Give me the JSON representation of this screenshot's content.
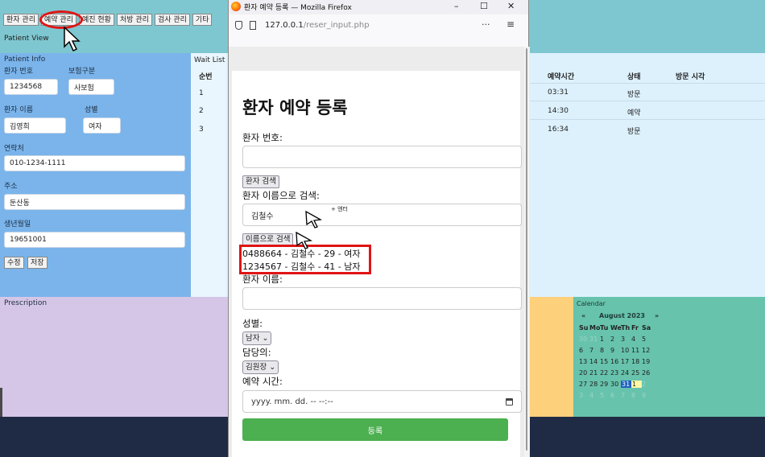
{
  "bg_app": {
    "menu": [
      "환자 관리",
      "예약 관리",
      "예진 현황",
      "처방 관리",
      "검사 관리",
      "기타"
    ],
    "patient_view": "Patient View",
    "patient_info": {
      "title": "Patient Info",
      "patient_no_label": "환자 번호",
      "insurance_label": "보험구분",
      "patient_no": "1234568",
      "insurance": "사보험",
      "name_label": "환자 이름",
      "gender_label": "성별",
      "name": "김영희",
      "gender": "여자",
      "contact_label": "연락처",
      "contact": "010-1234-1111",
      "address_label": "주소",
      "address": "둔산동",
      "birth_label": "생년월일",
      "birth": "19651001",
      "edit_btn": "수정",
      "save_btn": "저장"
    },
    "wait_list": {
      "title": "Wait List",
      "col_no": "순번",
      "col_time": "예약시간",
      "col_status": "상태",
      "col_visit": "방문 시각",
      "rows": [
        {
          "no": "1",
          "time": "03:31",
          "status": "방문"
        },
        {
          "no": "2",
          "time": "14:30",
          "status": "예약"
        },
        {
          "no": "3",
          "time": "16:34",
          "status": "방문"
        }
      ]
    },
    "prescription": "Prescription",
    "calendar": {
      "title": "Calendar",
      "prev": "«",
      "month": "August 2023",
      "next": "»",
      "days": [
        "Su",
        "Mo",
        "Tu",
        "We",
        "Th",
        "Fr",
        "Sa"
      ],
      "weeks": [
        [
          "30",
          "31",
          "1",
          "2",
          "3",
          "4",
          "5"
        ],
        [
          "6",
          "7",
          "8",
          "9",
          "10",
          "11",
          "12"
        ],
        [
          "13",
          "14",
          "15",
          "16",
          "17",
          "18",
          "19"
        ],
        [
          "20",
          "21",
          "22",
          "23",
          "24",
          "25",
          "26"
        ],
        [
          "27",
          "28",
          "29",
          "30",
          "31",
          "1",
          "2"
        ],
        [
          "3",
          "4",
          "5",
          "6",
          "7",
          "8",
          "9"
        ]
      ]
    }
  },
  "firefox": {
    "title": "환자 예약 등록 — Mozilla Firefox",
    "url_host": "127.0.0.1",
    "url_path": "/reser_input.php",
    "min": "–",
    "max": "☐",
    "close": "✕",
    "more": "···",
    "menu": "≡"
  },
  "form": {
    "title": "환자 예약 등록",
    "patient_no_label": "환자 번호:",
    "search_btn": "환자 검색",
    "name_search_label": "환자 이름으로 검색:",
    "name_search_value": "김철수",
    "enter_hint": "+ 엔터",
    "name_search_btn": "이름으로 검색",
    "results": [
      "0488664 - 김철수 - 29 - 여자",
      "1234567 - 김철수 - 41 - 남자"
    ],
    "name_label": "환자 이름:",
    "gender_label": "성별:",
    "gender_value": "남자",
    "doctor_label": "담당의:",
    "doctor_value": "김원장",
    "time_label": "예약 시간:",
    "time_placeholder": "yyyy. mm. dd. -- --:--",
    "submit": "등록"
  },
  "colors": {
    "accent_red": "#e01414",
    "submit_green": "#4caf50",
    "header_teal": "#7fc7d0",
    "info_blue": "#7ab4ea",
    "calendar_green": "#67c3ac"
  }
}
